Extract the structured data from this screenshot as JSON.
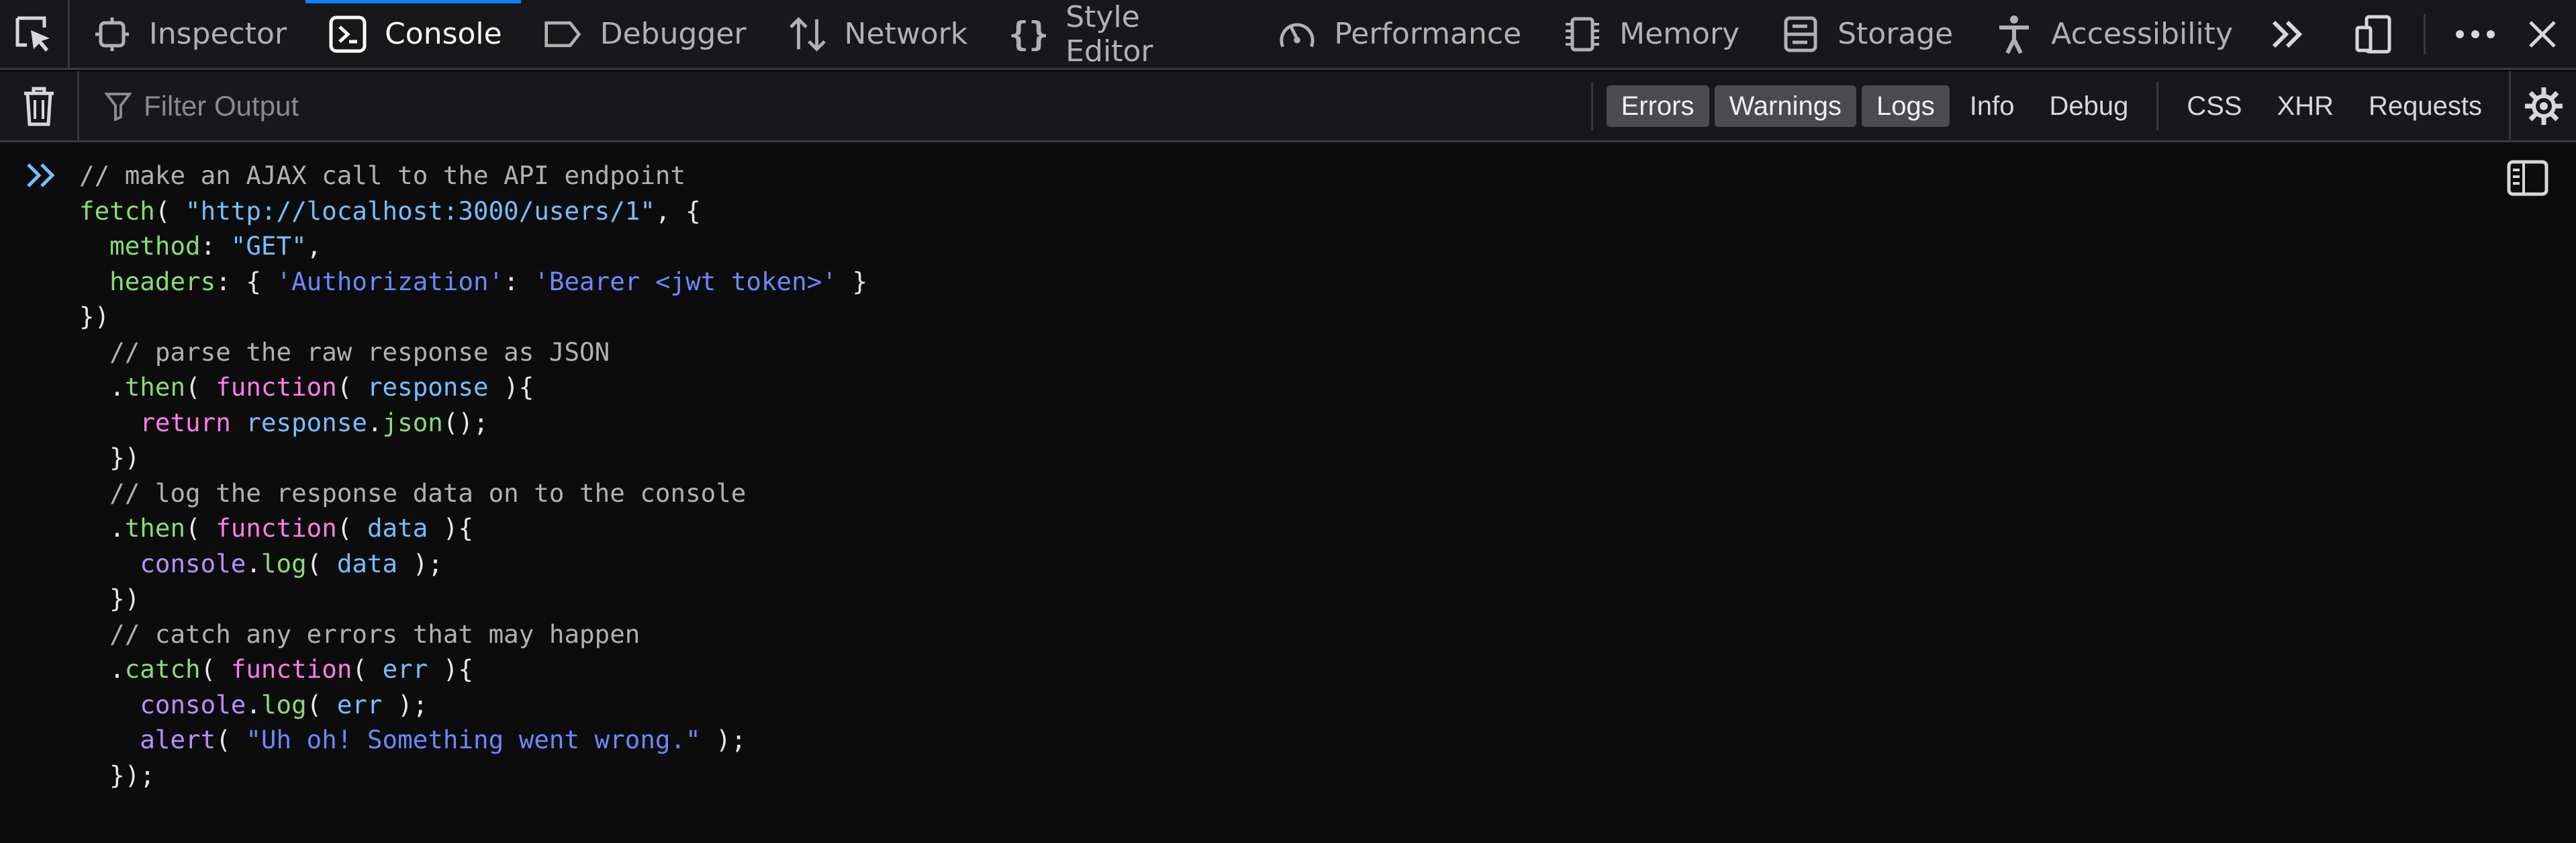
{
  "tabs": [
    {
      "label": "Inspector",
      "icon": "inspector-icon"
    },
    {
      "label": "Console",
      "icon": "console-icon",
      "selected": true
    },
    {
      "label": "Debugger",
      "icon": "debugger-icon"
    },
    {
      "label": "Network",
      "icon": "network-icon"
    },
    {
      "label": "Style Editor",
      "icon": "style-editor-icon"
    },
    {
      "label": "Performance",
      "icon": "performance-icon"
    },
    {
      "label": "Memory",
      "icon": "memory-icon"
    },
    {
      "label": "Storage",
      "icon": "storage-icon"
    },
    {
      "label": "Accessibility",
      "icon": "accessibility-icon"
    }
  ],
  "filter": {
    "placeholder": "Filter Output",
    "levels": [
      {
        "label": "Errors",
        "active": true
      },
      {
        "label": "Warnings",
        "active": true
      },
      {
        "label": "Logs",
        "active": true
      },
      {
        "label": "Info",
        "active": false
      },
      {
        "label": "Debug",
        "active": false
      }
    ],
    "types": [
      {
        "label": "CSS"
      },
      {
        "label": "XHR"
      },
      {
        "label": "Requests"
      }
    ]
  },
  "colors": {
    "accent": "#0a84ff",
    "background": "#0c0c0d",
    "toolbar": "#18181a",
    "comment": "#b1b1b3",
    "function": "#86de74",
    "string": "#75bfff",
    "keyword": "#ff7de9",
    "object": "#b98eff"
  },
  "code_lines": [
    [
      [
        "c",
        "// make an AJAX call to the API endpoint"
      ]
    ],
    [
      [
        "f",
        "fetch"
      ],
      [
        "p",
        "( "
      ],
      [
        "s",
        "\"http://localhost:3000/users/1\""
      ],
      [
        "p",
        ", {"
      ]
    ],
    [
      [
        "p",
        "  "
      ],
      [
        "pr",
        "method"
      ],
      [
        "p",
        ": "
      ],
      [
        "s",
        "\"GET\""
      ],
      [
        "p",
        ","
      ]
    ],
    [
      [
        "p",
        "  "
      ],
      [
        "pr",
        "headers"
      ],
      [
        "p",
        ": { "
      ],
      [
        "sb",
        "'Authorization'"
      ],
      [
        "p",
        ": "
      ],
      [
        "sb",
        "'Bearer <jwt token>'"
      ],
      [
        "p",
        " }"
      ]
    ],
    [
      [
        "p",
        "})"
      ]
    ],
    [
      [
        "p",
        "  "
      ],
      [
        "c",
        "// parse the raw response as JSON"
      ]
    ],
    [
      [
        "p",
        "  ."
      ],
      [
        "f",
        "then"
      ],
      [
        "p",
        "( "
      ],
      [
        "k",
        "function"
      ],
      [
        "p",
        "( "
      ],
      [
        "v",
        "response"
      ],
      [
        "p",
        " ){"
      ]
    ],
    [
      [
        "p",
        "    "
      ],
      [
        "k",
        "return"
      ],
      [
        "p",
        " "
      ],
      [
        "v",
        "response"
      ],
      [
        "p",
        "."
      ],
      [
        "f",
        "json"
      ],
      [
        "p",
        "();"
      ]
    ],
    [
      [
        "p",
        "  })"
      ]
    ],
    [
      [
        "p",
        "  "
      ],
      [
        "c",
        "// log the response data on to the console"
      ]
    ],
    [
      [
        "p",
        "  ."
      ],
      [
        "f",
        "then"
      ],
      [
        "p",
        "( "
      ],
      [
        "k",
        "function"
      ],
      [
        "p",
        "( "
      ],
      [
        "v",
        "data"
      ],
      [
        "p",
        " ){"
      ]
    ],
    [
      [
        "p",
        "    "
      ],
      [
        "o",
        "console"
      ],
      [
        "p",
        "."
      ],
      [
        "f",
        "log"
      ],
      [
        "p",
        "( "
      ],
      [
        "v",
        "data"
      ],
      [
        "p",
        " );"
      ]
    ],
    [
      [
        "p",
        "  })"
      ]
    ],
    [
      [
        "p",
        "  "
      ],
      [
        "c",
        "// catch any errors that may happen"
      ]
    ],
    [
      [
        "p",
        "  ."
      ],
      [
        "f",
        "catch"
      ],
      [
        "p",
        "( "
      ],
      [
        "k",
        "function"
      ],
      [
        "p",
        "( "
      ],
      [
        "v",
        "err"
      ],
      [
        "p",
        " ){"
      ]
    ],
    [
      [
        "p",
        "    "
      ],
      [
        "o",
        "console"
      ],
      [
        "p",
        "."
      ],
      [
        "f",
        "log"
      ],
      [
        "p",
        "( "
      ],
      [
        "v",
        "err"
      ],
      [
        "p",
        " );"
      ]
    ],
    [
      [
        "p",
        "    "
      ],
      [
        "o",
        "alert"
      ],
      [
        "p",
        "( "
      ],
      [
        "sb",
        "\"Uh oh! Something went wrong.\""
      ],
      [
        "p",
        " );"
      ]
    ],
    [
      [
        "p",
        "  });"
      ]
    ]
  ]
}
